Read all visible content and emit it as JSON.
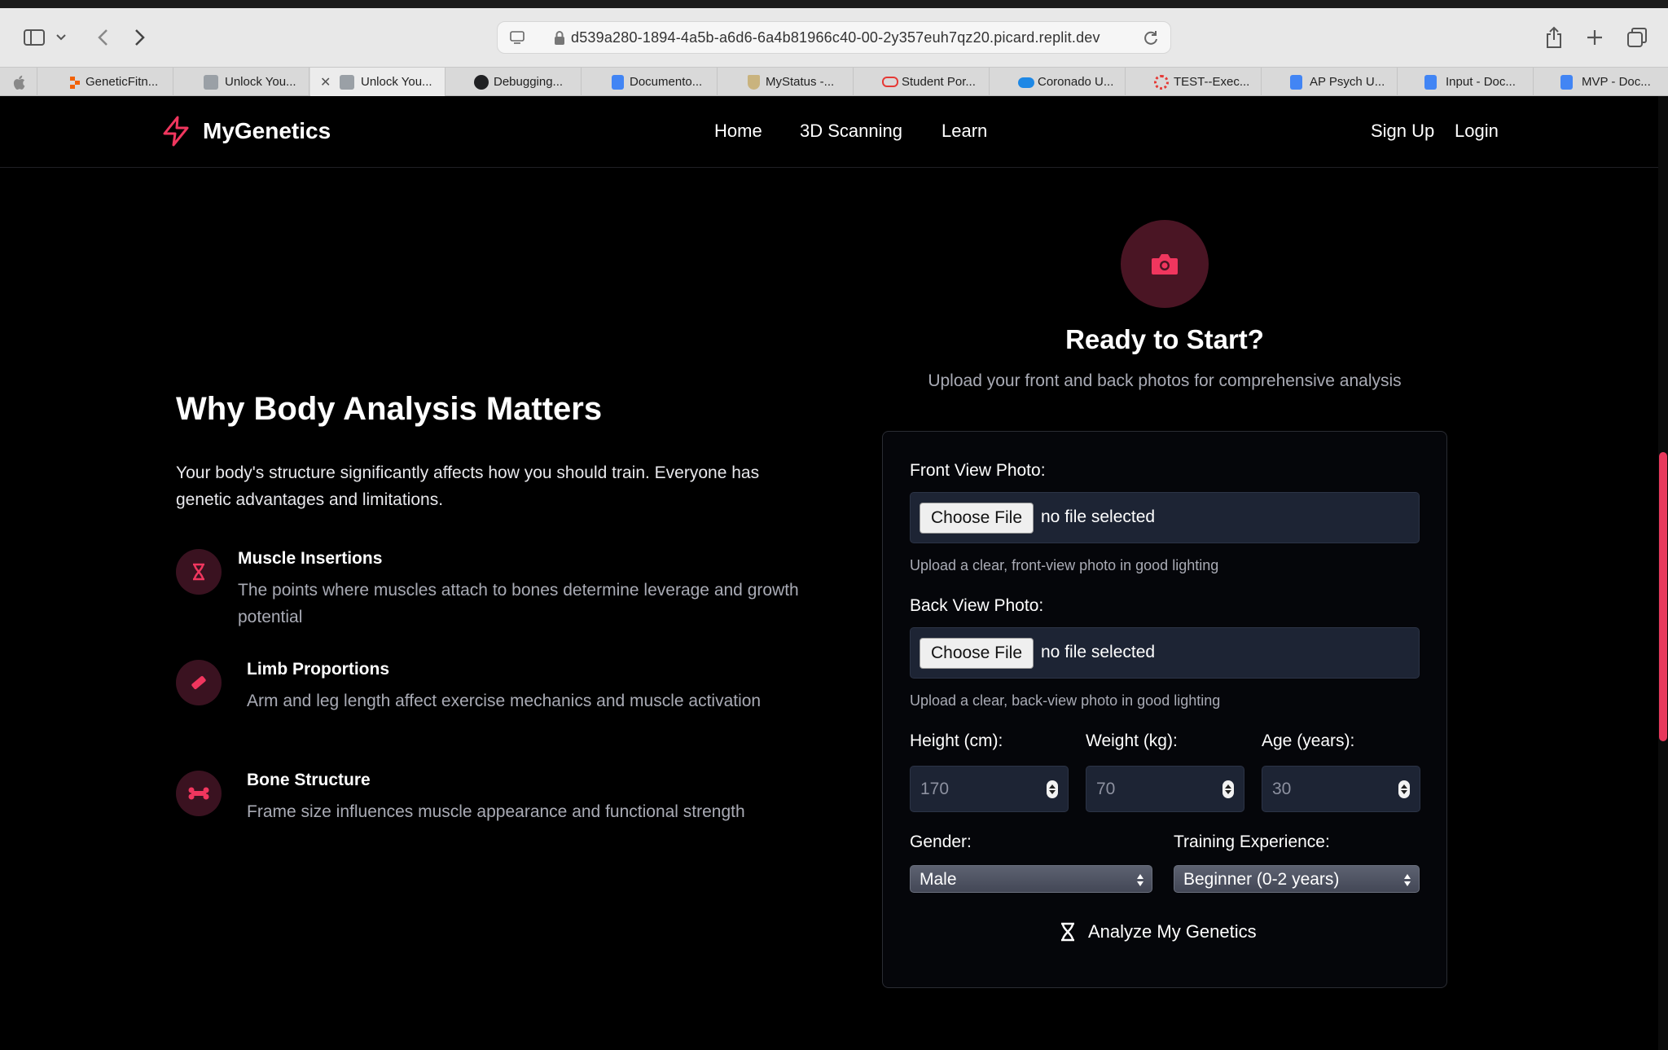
{
  "browser": {
    "url": "d539a280-1894-4a5b-a6d6-6a4b81966c40-00-2y357euh7qz20.picard.replit.dev",
    "tabs": [
      {
        "label": "GeneticFitn...",
        "favicon_color": "#f26207"
      },
      {
        "label": "Unlock You...",
        "favicon_color": "#9aa0a6"
      },
      {
        "label": "Unlock You...",
        "favicon_color": "#9aa0a6"
      },
      {
        "label": "Debugging...",
        "favicon_color": "#202123"
      },
      {
        "label": "Documento...",
        "favicon_color": "#4285f4"
      },
      {
        "label": "MyStatus -...",
        "favicon_color": "#c9b37e"
      },
      {
        "label": "Student Por...",
        "favicon_color": "#e53935"
      },
      {
        "label": "Coronado U...",
        "favicon_color": "#1e88e5"
      },
      {
        "label": "TEST--Exec...",
        "favicon_color": "#e53935"
      },
      {
        "label": "AP Psych U...",
        "favicon_color": "#4285f4"
      },
      {
        "label": "Input - Doc...",
        "favicon_color": "#4285f4"
      },
      {
        "label": "MVP - Doc...",
        "favicon_color": "#4285f4"
      }
    ]
  },
  "nav": {
    "brand": "MyGenetics",
    "links": [
      "Home",
      "3D Scanning",
      "Learn"
    ],
    "signup": "Sign Up",
    "login": "Login"
  },
  "why": {
    "title": "Why Body Analysis Matters",
    "desc": "Your body's structure significantly affects how you should train. Everyone has genetic advantages and limitations.",
    "features": [
      {
        "icon": "dna-icon",
        "title": "Muscle Insertions",
        "desc": "The points where muscles attach to bones determine leverage and growth potential"
      },
      {
        "icon": "ruler-icon",
        "title": "Limb Proportions",
        "desc": "Arm and leg length affect exercise mechanics and muscle activation"
      },
      {
        "icon": "bone-icon",
        "title": "Bone Structure",
        "desc": "Frame size influences muscle appearance and functional strength"
      }
    ]
  },
  "upload": {
    "title": "Ready to Start?",
    "subtitle": "Upload your front and back photos for comprehensive analysis",
    "front_label": "Front View Photo:",
    "front_hint": "Upload a clear, front-view photo in good lighting",
    "back_label": "Back View Photo:",
    "back_hint": "Upload a clear, back-view photo in good lighting",
    "choose_file": "Choose File",
    "no_file": "no file selected",
    "height_label": "Height (cm):",
    "height_value": "170",
    "weight_label": "Weight (kg):",
    "weight_value": "70",
    "age_label": "Age (years):",
    "age_value": "30",
    "gender_label": "Gender:",
    "gender_value": "Male",
    "experience_label": "Training Experience:",
    "experience_value": "Beginner (0-2 years)",
    "analyze_label": "Analyze My Genetics"
  },
  "colors": {
    "accent": "#f0365e",
    "icon_bg": "#3a1220",
    "input_bg": "#1d2434"
  }
}
